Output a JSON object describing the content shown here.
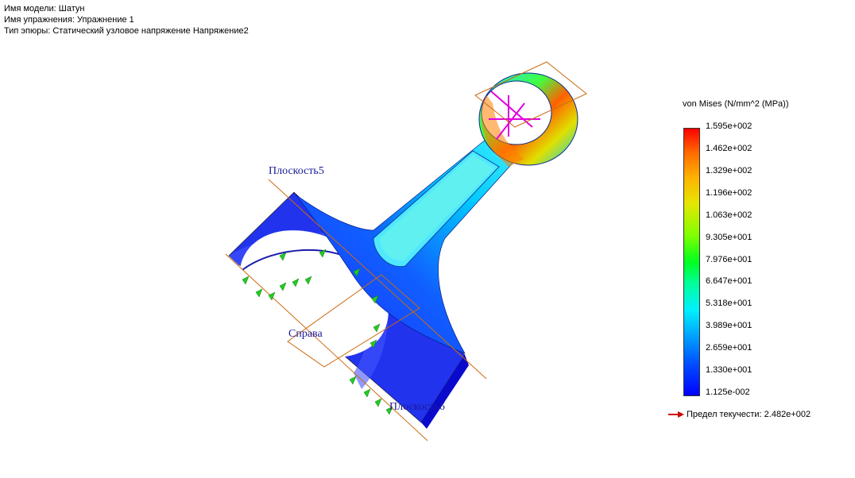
{
  "header": {
    "model_name": "Имя модели: Шатун",
    "study_name": "Имя упражнения: Упражнение 1",
    "plot_type": "Тип эпюры: Статический узловое напряжение Напряжение2"
  },
  "scene": {
    "plane_labels": [
      "Плоскость5",
      "Справа",
      "Плоскость6"
    ]
  },
  "legend": {
    "title": "von Mises (N/mm^2 (MPa))",
    "ticks": [
      "1.595e+002",
      "1.462e+002",
      "1.329e+002",
      "1.196e+002",
      "1.063e+002",
      "9.305e+001",
      "7.976e+001",
      "6.647e+001",
      "5.318e+001",
      "3.989e+001",
      "2.659e+001",
      "1.330e+001",
      "1.125e-002"
    ],
    "yield_label": "Предел текучести: 2.482e+002",
    "yield_arrow_color": "#cc0000"
  }
}
